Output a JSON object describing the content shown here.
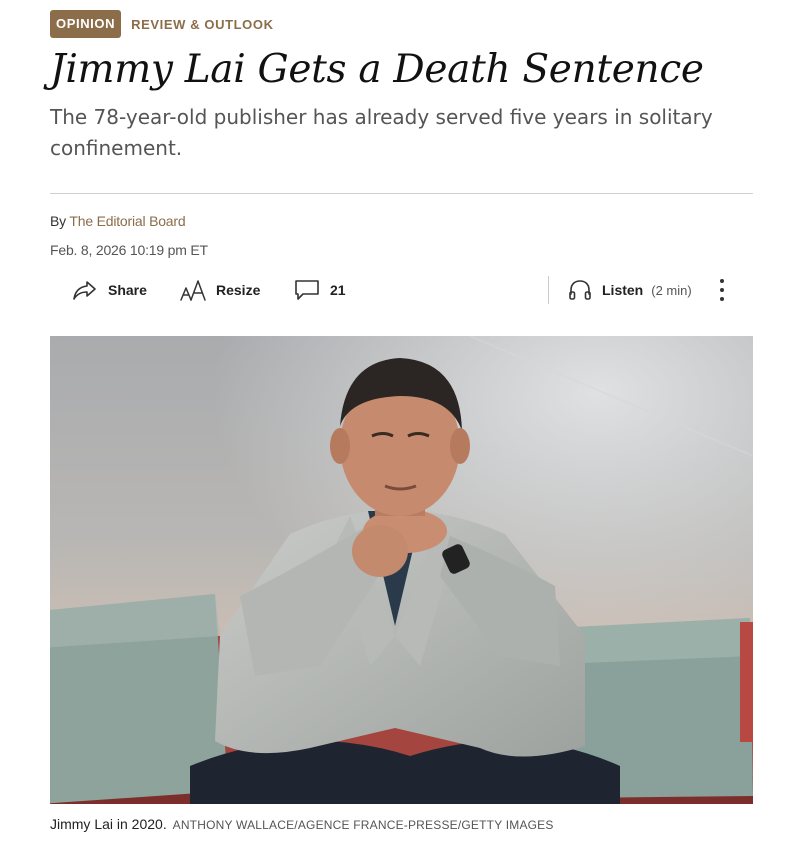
{
  "kicker": {
    "badge": "Opinion",
    "section": "Review & Outlook"
  },
  "article": {
    "headline": "Jimmy Lai Gets a Death Sentence",
    "dek": "The 78-year-old publisher has already served five years in solitary confinement.",
    "byline_prefix": "By",
    "author": "The Editorial Board",
    "date": "Feb. 8, 2026 10:19 pm ET"
  },
  "toolbar": {
    "share_label": "Share",
    "resize_label": "Resize",
    "comments_count": "21",
    "listen_label": "Listen",
    "listen_duration": "(2 min)"
  },
  "icons": {
    "share": "share-arrow-icon",
    "resize": "text-resize-icon",
    "comments": "comment-bubble-icon",
    "listen": "headphones-icon",
    "more": "vertical-ellipsis-icon"
  },
  "image": {
    "caption": "Jimmy Lai in 2020.",
    "credit": "ANTHONY WALLACE/AGENCE FRANCE-PRESSE/GETTY IMAGES"
  },
  "colors": {
    "accent": "#8b6d4a",
    "headline": "#111111",
    "dek": "#555555",
    "rule": "#cfcfcf"
  }
}
